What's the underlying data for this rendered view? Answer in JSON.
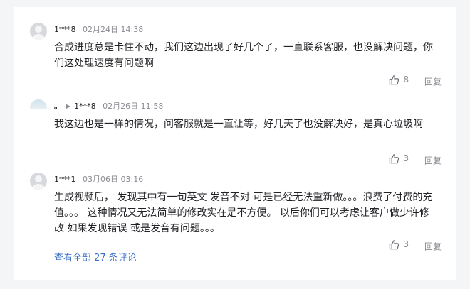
{
  "comments": [
    {
      "user": "1***8",
      "time": "02月24日 14:38",
      "text": "合成进度总是卡住不动，我们这边出现了好几个了，一直联系客服，也没解决问题，你们这处理速度有问题啊",
      "likes": "8",
      "reply_label": "回复",
      "avatar": "default-avatar"
    },
    {
      "user_prefix": "。",
      "reply_to": "1***8",
      "time": "02月26日 11:58",
      "text": "我这边也是一样的情况，问客服就是一直让等，好几天了也没解决好，是真心垃圾啊",
      "likes": "3",
      "reply_label": "回复",
      "avatar": "scenery-avatar"
    },
    {
      "user": "1***1",
      "time": "03月06日 03:16",
      "text": "生成视频后， 发现其中有一句英文 发音不对 可是已经无法重新做。。。浪费了付费的充值。。。 这种情况又无法简单的修改实在是不方便。 以后你们可以考虑让客户做少许修改 如果发现错误 或是发音有问题。。。",
      "likes": "3",
      "reply_label": "回复",
      "avatar": "default-avatar"
    }
  ],
  "view_all": "查看全部 27 条评论",
  "colors": {
    "link": "#3a6fc4",
    "muted": "#8a8a92",
    "text": "#222226"
  }
}
